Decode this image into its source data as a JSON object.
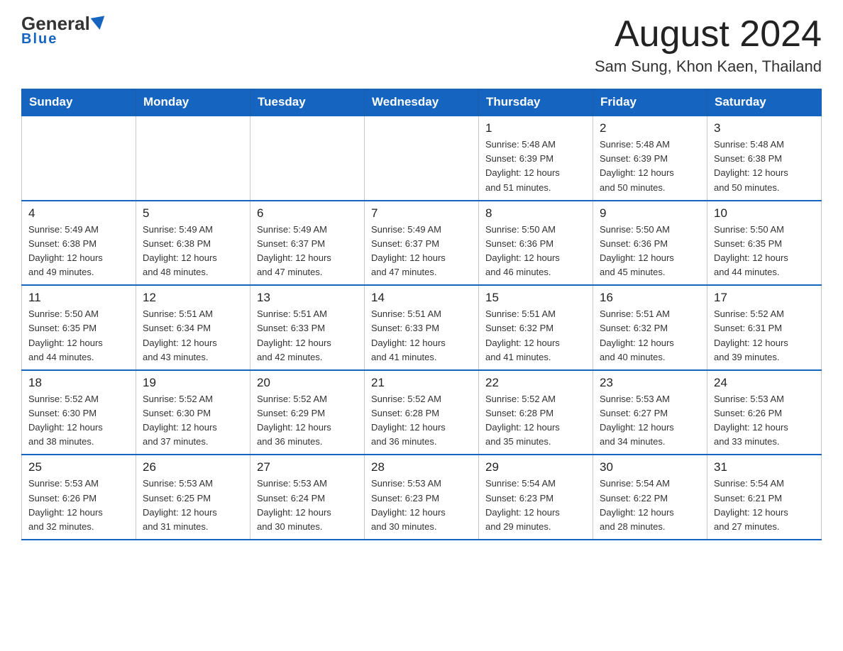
{
  "logo": {
    "general": "General",
    "blue": "Blue"
  },
  "title": "August 2024",
  "subtitle": "Sam Sung, Khon Kaen, Thailand",
  "days_of_week": [
    "Sunday",
    "Monday",
    "Tuesday",
    "Wednesday",
    "Thursday",
    "Friday",
    "Saturday"
  ],
  "weeks": [
    [
      {
        "day": "",
        "info": ""
      },
      {
        "day": "",
        "info": ""
      },
      {
        "day": "",
        "info": ""
      },
      {
        "day": "",
        "info": ""
      },
      {
        "day": "1",
        "info": "Sunrise: 5:48 AM\nSunset: 6:39 PM\nDaylight: 12 hours\nand 51 minutes."
      },
      {
        "day": "2",
        "info": "Sunrise: 5:48 AM\nSunset: 6:39 PM\nDaylight: 12 hours\nand 50 minutes."
      },
      {
        "day": "3",
        "info": "Sunrise: 5:48 AM\nSunset: 6:38 PM\nDaylight: 12 hours\nand 50 minutes."
      }
    ],
    [
      {
        "day": "4",
        "info": "Sunrise: 5:49 AM\nSunset: 6:38 PM\nDaylight: 12 hours\nand 49 minutes."
      },
      {
        "day": "5",
        "info": "Sunrise: 5:49 AM\nSunset: 6:38 PM\nDaylight: 12 hours\nand 48 minutes."
      },
      {
        "day": "6",
        "info": "Sunrise: 5:49 AM\nSunset: 6:37 PM\nDaylight: 12 hours\nand 47 minutes."
      },
      {
        "day": "7",
        "info": "Sunrise: 5:49 AM\nSunset: 6:37 PM\nDaylight: 12 hours\nand 47 minutes."
      },
      {
        "day": "8",
        "info": "Sunrise: 5:50 AM\nSunset: 6:36 PM\nDaylight: 12 hours\nand 46 minutes."
      },
      {
        "day": "9",
        "info": "Sunrise: 5:50 AM\nSunset: 6:36 PM\nDaylight: 12 hours\nand 45 minutes."
      },
      {
        "day": "10",
        "info": "Sunrise: 5:50 AM\nSunset: 6:35 PM\nDaylight: 12 hours\nand 44 minutes."
      }
    ],
    [
      {
        "day": "11",
        "info": "Sunrise: 5:50 AM\nSunset: 6:35 PM\nDaylight: 12 hours\nand 44 minutes."
      },
      {
        "day": "12",
        "info": "Sunrise: 5:51 AM\nSunset: 6:34 PM\nDaylight: 12 hours\nand 43 minutes."
      },
      {
        "day": "13",
        "info": "Sunrise: 5:51 AM\nSunset: 6:33 PM\nDaylight: 12 hours\nand 42 minutes."
      },
      {
        "day": "14",
        "info": "Sunrise: 5:51 AM\nSunset: 6:33 PM\nDaylight: 12 hours\nand 41 minutes."
      },
      {
        "day": "15",
        "info": "Sunrise: 5:51 AM\nSunset: 6:32 PM\nDaylight: 12 hours\nand 41 minutes."
      },
      {
        "day": "16",
        "info": "Sunrise: 5:51 AM\nSunset: 6:32 PM\nDaylight: 12 hours\nand 40 minutes."
      },
      {
        "day": "17",
        "info": "Sunrise: 5:52 AM\nSunset: 6:31 PM\nDaylight: 12 hours\nand 39 minutes."
      }
    ],
    [
      {
        "day": "18",
        "info": "Sunrise: 5:52 AM\nSunset: 6:30 PM\nDaylight: 12 hours\nand 38 minutes."
      },
      {
        "day": "19",
        "info": "Sunrise: 5:52 AM\nSunset: 6:30 PM\nDaylight: 12 hours\nand 37 minutes."
      },
      {
        "day": "20",
        "info": "Sunrise: 5:52 AM\nSunset: 6:29 PM\nDaylight: 12 hours\nand 36 minutes."
      },
      {
        "day": "21",
        "info": "Sunrise: 5:52 AM\nSunset: 6:28 PM\nDaylight: 12 hours\nand 36 minutes."
      },
      {
        "day": "22",
        "info": "Sunrise: 5:52 AM\nSunset: 6:28 PM\nDaylight: 12 hours\nand 35 minutes."
      },
      {
        "day": "23",
        "info": "Sunrise: 5:53 AM\nSunset: 6:27 PM\nDaylight: 12 hours\nand 34 minutes."
      },
      {
        "day": "24",
        "info": "Sunrise: 5:53 AM\nSunset: 6:26 PM\nDaylight: 12 hours\nand 33 minutes."
      }
    ],
    [
      {
        "day": "25",
        "info": "Sunrise: 5:53 AM\nSunset: 6:26 PM\nDaylight: 12 hours\nand 32 minutes."
      },
      {
        "day": "26",
        "info": "Sunrise: 5:53 AM\nSunset: 6:25 PM\nDaylight: 12 hours\nand 31 minutes."
      },
      {
        "day": "27",
        "info": "Sunrise: 5:53 AM\nSunset: 6:24 PM\nDaylight: 12 hours\nand 30 minutes."
      },
      {
        "day": "28",
        "info": "Sunrise: 5:53 AM\nSunset: 6:23 PM\nDaylight: 12 hours\nand 30 minutes."
      },
      {
        "day": "29",
        "info": "Sunrise: 5:54 AM\nSunset: 6:23 PM\nDaylight: 12 hours\nand 29 minutes."
      },
      {
        "day": "30",
        "info": "Sunrise: 5:54 AM\nSunset: 6:22 PM\nDaylight: 12 hours\nand 28 minutes."
      },
      {
        "day": "31",
        "info": "Sunrise: 5:54 AM\nSunset: 6:21 PM\nDaylight: 12 hours\nand 27 minutes."
      }
    ]
  ]
}
